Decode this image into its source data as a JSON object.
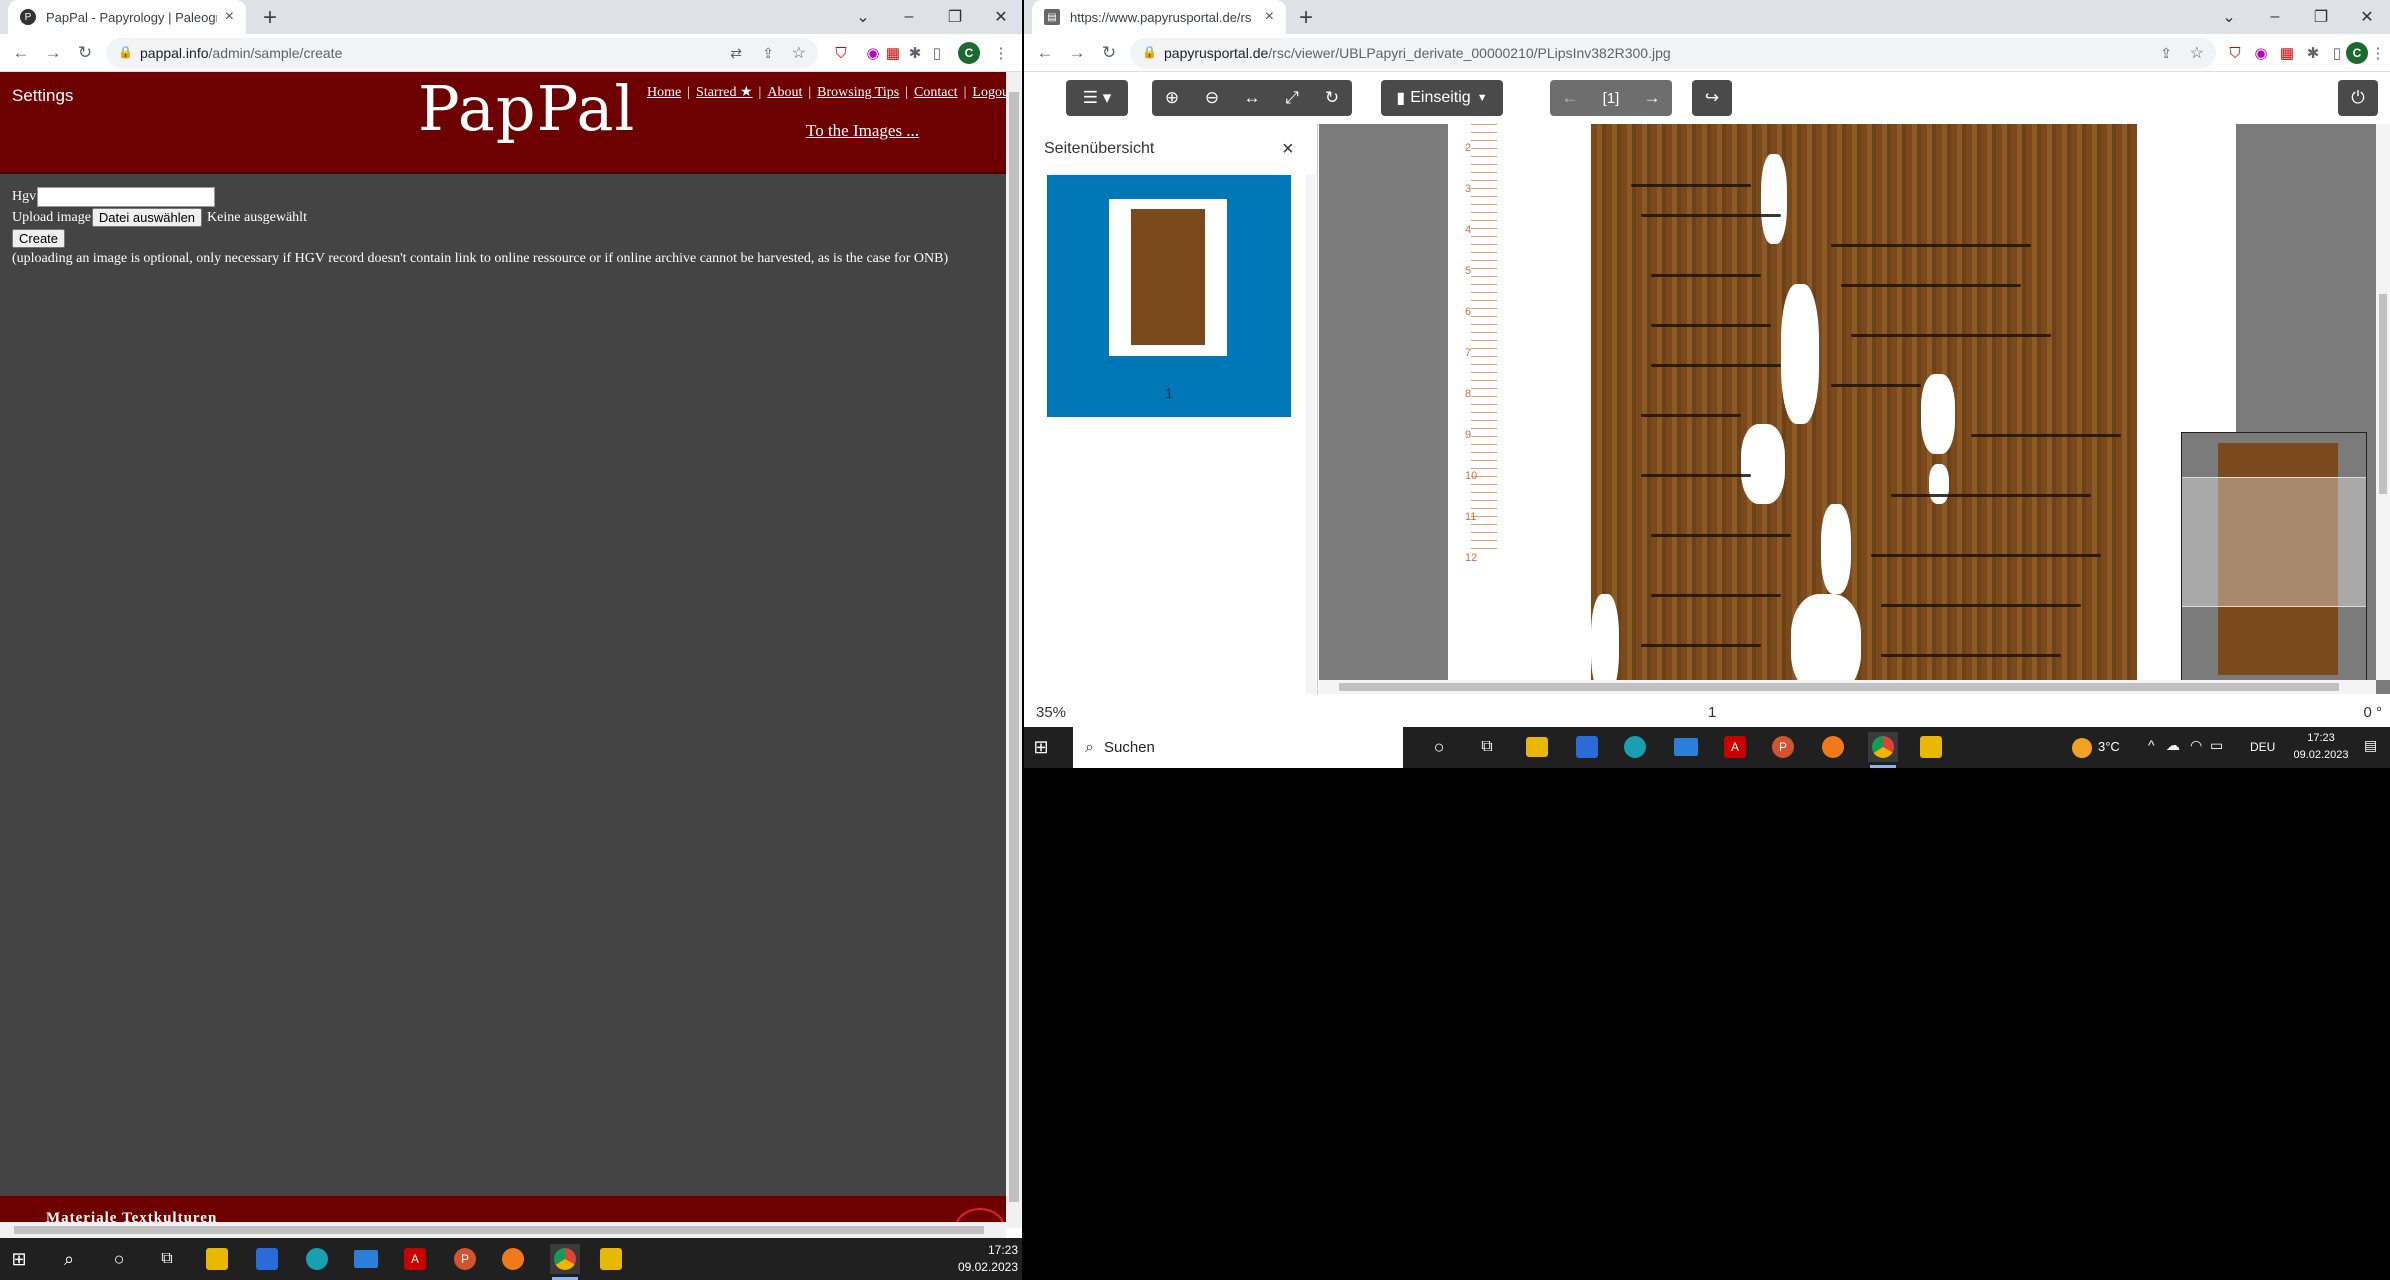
{
  "left_window": {
    "tab_title": "PapPal - Papyrology | Paleograph",
    "url_host": "pappal.info",
    "url_path": "/admin/sample/create",
    "profile_initial": "C",
    "header": {
      "settings": "Settings",
      "logo": "PapPal",
      "nav": [
        "Home",
        "Starred ★",
        "About",
        "Browsing Tips",
        "Contact",
        "Logout"
      ],
      "images_link": "To the Images ..."
    },
    "form": {
      "hgv_label": "Hgv",
      "hgv_value": "",
      "upload_label": "Upload image",
      "file_button": "Datei auswählen",
      "file_status": "Keine ausgewählt",
      "create_button": "Create",
      "note": "(uploading an image is optional, only necessary if HGV record doesn't contain link to online ressource or if online archive cannot be harvested, as is the case for ONB)"
    },
    "footer": "Materiale Textkulturen",
    "taskbar_time": "17:23",
    "taskbar_date": "09.02.2023"
  },
  "right_window": {
    "tab_title": "https://www.papyrusportal.de/rs",
    "url_host": "papyrusportal.de",
    "url_path": "/rsc/viewer/UBLPapyri_derivate_00000210/PLipsInv382R300.jpg",
    "profile_initial": "C",
    "viewer": {
      "view_mode": "Einseitig",
      "page_indicator": "[1]",
      "sidebar_title": "Seitenübersicht",
      "thumb_label": "1",
      "zoom": "35%",
      "page": "1",
      "rotation": "0 °",
      "ruler_numbers": [
        "2",
        "3",
        "4",
        "5",
        "6",
        "7",
        "8",
        "9",
        "10",
        "11",
        "12"
      ]
    },
    "taskbar": {
      "search_placeholder": "Suchen",
      "weather": "3°C",
      "lang": "DEU",
      "time": "17:23",
      "date": "09.02.2023"
    }
  },
  "colors": {
    "pappal_red": "#6d0000",
    "pappal_body": "#444444",
    "thumb_blue": "#0078b8",
    "viewer_button": "#4a4a4a"
  }
}
